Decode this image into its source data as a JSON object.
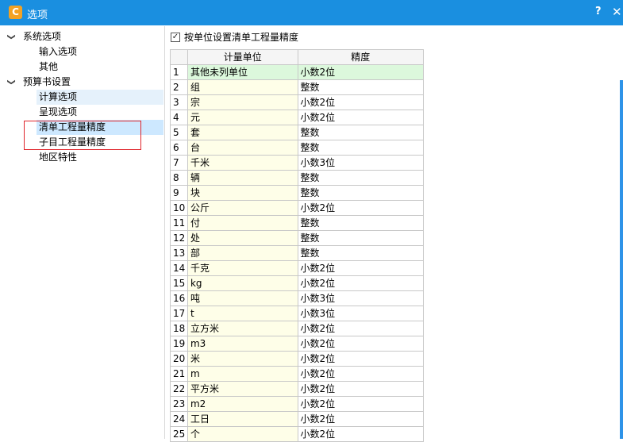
{
  "window": {
    "title": "选项",
    "app_icon_glyph": "C",
    "help_label": "?",
    "close_label": "✕"
  },
  "tree": {
    "sections": [
      {
        "label": "系统选项",
        "expanded": true,
        "children": [
          "输入选项",
          "其他"
        ]
      },
      {
        "label": "预算书设置",
        "expanded": true,
        "children": [
          "计算选项",
          "呈现选项",
          "清单工程量精度",
          "子目工程量精度",
          "地区特性"
        ]
      }
    ],
    "chevron_glyph": "❯",
    "selected_item": "清单工程量精度"
  },
  "option": {
    "checkbox_checked": true,
    "checkbox_mark": "✓",
    "label": "按单位设置清单工程量精度"
  },
  "grid": {
    "columns": [
      "",
      "计量单位",
      "精度"
    ],
    "rows": [
      [
        "1",
        "其他未列单位",
        "小数2位"
      ],
      [
        "2",
        "组",
        "整数"
      ],
      [
        "3",
        "宗",
        "小数2位"
      ],
      [
        "4",
        "元",
        "小数2位"
      ],
      [
        "5",
        "套",
        "整数"
      ],
      [
        "6",
        "台",
        "整数"
      ],
      [
        "7",
        "千米",
        "小数3位"
      ],
      [
        "8",
        "辆",
        "整数"
      ],
      [
        "9",
        "块",
        "整数"
      ],
      [
        "10",
        "公斤",
        "小数2位"
      ],
      [
        "11",
        "付",
        "整数"
      ],
      [
        "12",
        "处",
        "整数"
      ],
      [
        "13",
        "部",
        "整数"
      ],
      [
        "14",
        "千克",
        "小数2位"
      ],
      [
        "15",
        "kg",
        "小数2位"
      ],
      [
        "16",
        "吨",
        "小数3位"
      ],
      [
        "17",
        "t",
        "小数3位"
      ],
      [
        "18",
        "立方米",
        "小数2位"
      ],
      [
        "19",
        "m3",
        "小数2位"
      ],
      [
        "20",
        "米",
        "小数2位"
      ],
      [
        "21",
        "m",
        "小数2位"
      ],
      [
        "22",
        "平方米",
        "小数2位"
      ],
      [
        "23",
        "m2",
        "小数2位"
      ],
      [
        "24",
        "工日",
        "小数2位"
      ],
      [
        "25",
        "个",
        "小数2位"
      ]
    ]
  },
  "colors": {
    "titlebar": "#1a8fe0",
    "selection": "#cde8ff",
    "highlight_box": "#e0262c",
    "unit_column": "#fefee8",
    "first_row": "#dcf8dc"
  }
}
